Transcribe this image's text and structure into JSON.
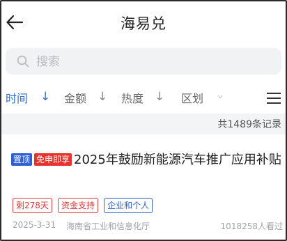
{
  "header": {
    "title": "海易兑",
    "back_icon": "back-arrow-icon"
  },
  "search": {
    "placeholder": "搜索",
    "value": "",
    "icon": "search-icon"
  },
  "filters": [
    {
      "label": "时间",
      "active": true,
      "sort_icon": "arrow-down-icon"
    },
    {
      "label": "金额",
      "active": false,
      "sort_icon": "arrow-down-icon"
    },
    {
      "label": "热度",
      "active": false,
      "sort_icon": "arrow-down-icon"
    },
    {
      "label": "区划",
      "active": false,
      "dropdown_icon": "chevron-down-icon"
    }
  ],
  "menu_icon": "list-menu-icon",
  "count_text": "共1489条记录",
  "card": {
    "tags": [
      "置顶",
      "免申即享"
    ],
    "title": "2025年鼓励新能源汽车推广应用补贴",
    "badges": [
      "剩278天",
      "资金支持",
      "企业和个人"
    ],
    "date": "2025-3-31",
    "department": "海南省工业和信息化厅",
    "views": "1018258人看过"
  },
  "colors": {
    "accent_blue": "#2f6fd6",
    "tag_top": "#2f5fd0",
    "tag_free": "#e5342d",
    "badge_red": "#e1363a",
    "badge_blue": "#2f62c9"
  }
}
